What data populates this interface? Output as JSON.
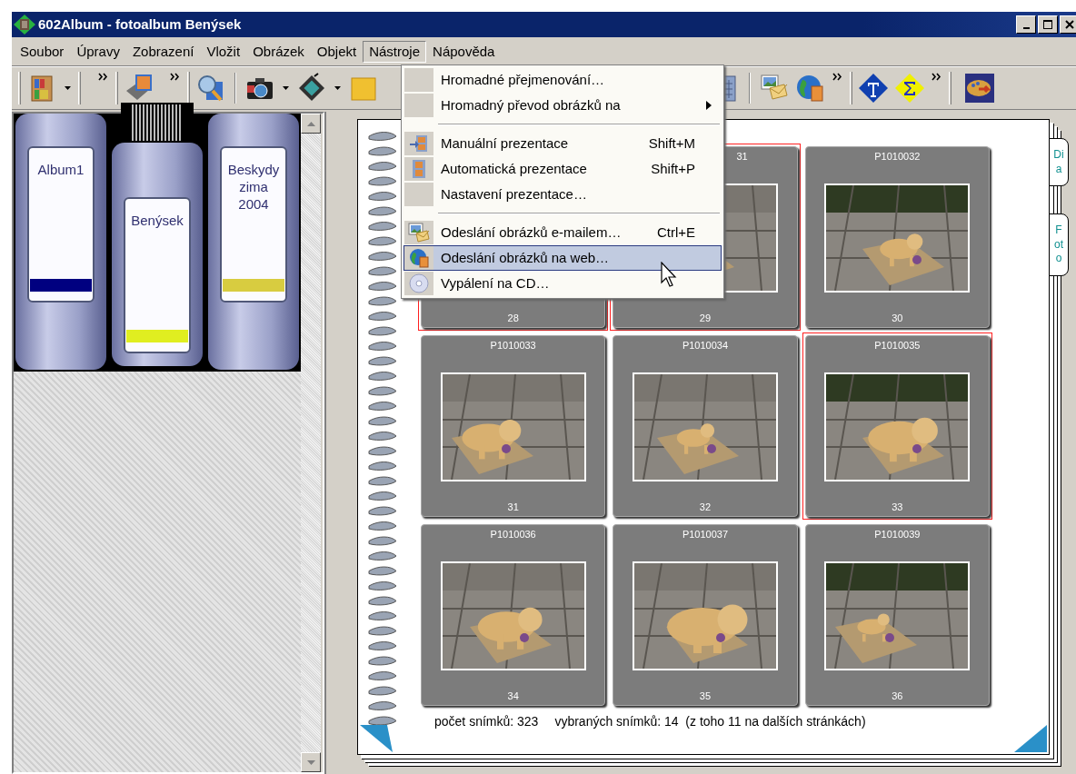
{
  "window": {
    "title": "602Album - fotoalbum Benýsek"
  },
  "menu_bar": [
    {
      "label": "Soubor",
      "selected": false
    },
    {
      "label": "Úpravy",
      "selected": false
    },
    {
      "label": "Zobrazení",
      "selected": false
    },
    {
      "label": "Vložit",
      "selected": false
    },
    {
      "label": "Obrázek",
      "selected": false
    },
    {
      "label": "Objekt",
      "selected": false
    },
    {
      "label": "Nástroje",
      "selected": true
    },
    {
      "label": "Nápověda",
      "selected": false
    }
  ],
  "dropdown_menu": [
    {
      "kind": "item",
      "label": "Hromadné přejmenování…",
      "selected": false
    },
    {
      "kind": "item",
      "label": "Hromadný převod obrázků na",
      "submenu": true,
      "selected": false
    },
    {
      "kind": "separator"
    },
    {
      "kind": "item",
      "label": "Manuální prezentace",
      "shortcut": "Shift+M",
      "selected": false
    },
    {
      "kind": "item",
      "label": "Automatická prezentace",
      "shortcut": "Shift+P",
      "selected": false
    },
    {
      "kind": "item",
      "label": "Nastavení prezentace…",
      "selected": false
    },
    {
      "kind": "separator"
    },
    {
      "kind": "item",
      "label": "Odeslání obrázků e-mailem…",
      "shortcut": "Ctrl+E",
      "selected": false
    },
    {
      "kind": "item",
      "label": "Odeslání obrázků na web…",
      "selected": true
    },
    {
      "kind": "item",
      "label": "Vypálení na CD…",
      "selected": false
    }
  ],
  "albums": [
    {
      "name": "Album1",
      "color": "#000080",
      "selected": false
    },
    {
      "name": "Benýsek",
      "color": "#e0ee20",
      "selected": true
    },
    {
      "name": "Beskydy zima 2004",
      "color": "#d8cc40",
      "selected": false
    }
  ],
  "slides": [
    {
      "number": "28",
      "selected": true
    },
    {
      "title": "31",
      "title_cut": true,
      "number": "29",
      "selected": true
    },
    {
      "title": "P1010032",
      "number": "30",
      "selected": false
    },
    {
      "title": "P1010033",
      "number": "31",
      "selected": false
    },
    {
      "title": "P1010034",
      "number": "32",
      "selected": false
    },
    {
      "title": "P1010035",
      "number": "33",
      "selected": true
    },
    {
      "title": "P1010036",
      "number": "34",
      "selected": false
    },
    {
      "title": "P1010037",
      "number": "35",
      "selected": false
    },
    {
      "title": "P1010039",
      "number": "36",
      "selected": false
    }
  ],
  "side_tabs": [
    {
      "label": "Dia"
    },
    {
      "label": "Foto"
    }
  ],
  "status": {
    "count": "počet snímků: 323",
    "selection": "vybraných snímků: 14  (z toho 11 na dalších stránkách)"
  }
}
